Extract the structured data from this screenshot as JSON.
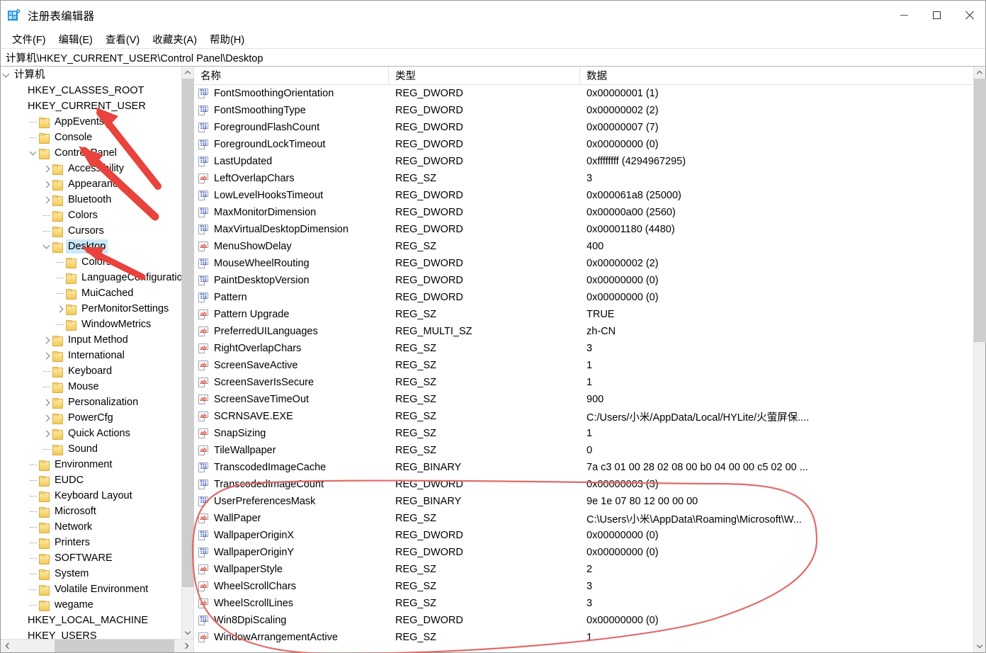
{
  "window": {
    "title": "注册表编辑器",
    "icon": "registry-editor-icon",
    "minimize_label": "最小化",
    "maximize_label": "最大化",
    "close_label": "关闭"
  },
  "menu": {
    "items": [
      {
        "label": "文件(F)",
        "name": "menu-file"
      },
      {
        "label": "编辑(E)",
        "name": "menu-edit"
      },
      {
        "label": "查看(V)",
        "name": "menu-view"
      },
      {
        "label": "收藏夹(A)",
        "name": "menu-favorites"
      },
      {
        "label": "帮助(H)",
        "name": "menu-help"
      }
    ]
  },
  "address": {
    "path": "计算机\\HKEY_CURRENT_USER\\Control Panel\\Desktop"
  },
  "tree": {
    "nodes": [
      {
        "label": "计算机",
        "indent": 0,
        "expander": "open",
        "folder": false,
        "selected": false
      },
      {
        "label": "HKEY_CLASSES_ROOT",
        "indent": 1,
        "expander": "collapsed-hidden",
        "folder": false,
        "selected": false
      },
      {
        "label": "HKEY_CURRENT_USER",
        "indent": 1,
        "expander": "collapsed-hidden",
        "folder": false,
        "selected": false
      },
      {
        "label": "AppEvents",
        "indent": 2,
        "expander": "dot",
        "folder": true,
        "selected": false
      },
      {
        "label": "Console",
        "indent": 2,
        "expander": "dot",
        "folder": true,
        "selected": false
      },
      {
        "label": "Control Panel",
        "indent": 2,
        "expander": "open",
        "folder": true,
        "selected": false
      },
      {
        "label": "Accessibility",
        "indent": 3,
        "expander": "closed",
        "folder": true,
        "selected": false
      },
      {
        "label": "Appearance",
        "indent": 3,
        "expander": "closed",
        "folder": true,
        "selected": false
      },
      {
        "label": "Bluetooth",
        "indent": 3,
        "expander": "closed",
        "folder": true,
        "selected": false
      },
      {
        "label": "Colors",
        "indent": 3,
        "expander": "dot",
        "folder": true,
        "selected": false
      },
      {
        "label": "Cursors",
        "indent": 3,
        "expander": "dot",
        "folder": true,
        "selected": false
      },
      {
        "label": "Desktop",
        "indent": 3,
        "expander": "open",
        "folder": true,
        "selected": true
      },
      {
        "label": "Colors",
        "indent": 4,
        "expander": "dot",
        "folder": true,
        "selected": false
      },
      {
        "label": "LanguageConfiguration",
        "indent": 4,
        "expander": "dot",
        "folder": true,
        "selected": false
      },
      {
        "label": "MuiCached",
        "indent": 4,
        "expander": "dot",
        "folder": true,
        "selected": false
      },
      {
        "label": "PerMonitorSettings",
        "indent": 4,
        "expander": "closed",
        "folder": true,
        "selected": false
      },
      {
        "label": "WindowMetrics",
        "indent": 4,
        "expander": "dot",
        "folder": true,
        "selected": false
      },
      {
        "label": "Input Method",
        "indent": 3,
        "expander": "closed",
        "folder": true,
        "selected": false
      },
      {
        "label": "International",
        "indent": 3,
        "expander": "closed",
        "folder": true,
        "selected": false
      },
      {
        "label": "Keyboard",
        "indent": 3,
        "expander": "dot",
        "folder": true,
        "selected": false
      },
      {
        "label": "Mouse",
        "indent": 3,
        "expander": "dot",
        "folder": true,
        "selected": false
      },
      {
        "label": "Personalization",
        "indent": 3,
        "expander": "closed",
        "folder": true,
        "selected": false
      },
      {
        "label": "PowerCfg",
        "indent": 3,
        "expander": "closed",
        "folder": true,
        "selected": false
      },
      {
        "label": "Quick Actions",
        "indent": 3,
        "expander": "closed",
        "folder": true,
        "selected": false
      },
      {
        "label": "Sound",
        "indent": 3,
        "expander": "dot",
        "folder": true,
        "selected": false
      },
      {
        "label": "Environment",
        "indent": 2,
        "expander": "dot",
        "folder": true,
        "selected": false
      },
      {
        "label": "EUDC",
        "indent": 2,
        "expander": "dot",
        "folder": true,
        "selected": false
      },
      {
        "label": "Keyboard Layout",
        "indent": 2,
        "expander": "dot",
        "folder": true,
        "selected": false
      },
      {
        "label": "Microsoft",
        "indent": 2,
        "expander": "dot",
        "folder": true,
        "selected": false
      },
      {
        "label": "Network",
        "indent": 2,
        "expander": "dot",
        "folder": true,
        "selected": false
      },
      {
        "label": "Printers",
        "indent": 2,
        "expander": "dot",
        "folder": true,
        "selected": false
      },
      {
        "label": "SOFTWARE",
        "indent": 2,
        "expander": "dot",
        "folder": true,
        "selected": false
      },
      {
        "label": "System",
        "indent": 2,
        "expander": "dot",
        "folder": true,
        "selected": false
      },
      {
        "label": "Volatile Environment",
        "indent": 2,
        "expander": "dot",
        "folder": true,
        "selected": false
      },
      {
        "label": "wegame",
        "indent": 2,
        "expander": "dot",
        "folder": true,
        "selected": false
      },
      {
        "label": "HKEY_LOCAL_MACHINE",
        "indent": 1,
        "expander": "collapsed-hidden",
        "folder": false,
        "selected": false
      },
      {
        "label": "HKEY_USERS",
        "indent": 1,
        "expander": "collapsed-hidden",
        "folder": false,
        "selected": false
      }
    ]
  },
  "list": {
    "columns": [
      {
        "label": "名称",
        "name": "column-header-name"
      },
      {
        "label": "类型",
        "name": "column-header-type"
      },
      {
        "label": "数据",
        "name": "column-header-data"
      }
    ],
    "rows": [
      {
        "icon": "dword-icon",
        "name": "FontSmoothingOrientation",
        "type": "REG_DWORD",
        "data": "0x00000001 (1)"
      },
      {
        "icon": "dword-icon",
        "name": "FontSmoothingType",
        "type": "REG_DWORD",
        "data": "0x00000002 (2)"
      },
      {
        "icon": "dword-icon",
        "name": "ForegroundFlashCount",
        "type": "REG_DWORD",
        "data": "0x00000007 (7)"
      },
      {
        "icon": "dword-icon",
        "name": "ForegroundLockTimeout",
        "type": "REG_DWORD",
        "data": "0x00000000 (0)"
      },
      {
        "icon": "dword-icon",
        "name": "LastUpdated",
        "type": "REG_DWORD",
        "data": "0xffffffff (4294967295)"
      },
      {
        "icon": "string-icon",
        "name": "LeftOverlapChars",
        "type": "REG_SZ",
        "data": "3"
      },
      {
        "icon": "dword-icon",
        "name": "LowLevelHooksTimeout",
        "type": "REG_DWORD",
        "data": "0x000061a8 (25000)"
      },
      {
        "icon": "dword-icon",
        "name": "MaxMonitorDimension",
        "type": "REG_DWORD",
        "data": "0x00000a00 (2560)"
      },
      {
        "icon": "dword-icon",
        "name": "MaxVirtualDesktopDimension",
        "type": "REG_DWORD",
        "data": "0x00001180 (4480)"
      },
      {
        "icon": "string-icon",
        "name": "MenuShowDelay",
        "type": "REG_SZ",
        "data": "400"
      },
      {
        "icon": "dword-icon",
        "name": "MouseWheelRouting",
        "type": "REG_DWORD",
        "data": "0x00000002 (2)"
      },
      {
        "icon": "dword-icon",
        "name": "PaintDesktopVersion",
        "type": "REG_DWORD",
        "data": "0x00000000 (0)"
      },
      {
        "icon": "dword-icon",
        "name": "Pattern",
        "type": "REG_DWORD",
        "data": "0x00000000 (0)"
      },
      {
        "icon": "string-icon",
        "name": "Pattern Upgrade",
        "type": "REG_SZ",
        "data": "TRUE"
      },
      {
        "icon": "string-icon",
        "name": "PreferredUILanguages",
        "type": "REG_MULTI_SZ",
        "data": "zh-CN"
      },
      {
        "icon": "string-icon",
        "name": "RightOverlapChars",
        "type": "REG_SZ",
        "data": "3"
      },
      {
        "icon": "string-icon",
        "name": "ScreenSaveActive",
        "type": "REG_SZ",
        "data": "1"
      },
      {
        "icon": "string-icon",
        "name": "ScreenSaverIsSecure",
        "type": "REG_SZ",
        "data": "1"
      },
      {
        "icon": "string-icon",
        "name": "ScreenSaveTimeOut",
        "type": "REG_SZ",
        "data": "900"
      },
      {
        "icon": "string-icon",
        "name": "SCRNSAVE.EXE",
        "type": "REG_SZ",
        "data": "C:/Users/小米/AppData/Local/HYLite/火萤屏保...."
      },
      {
        "icon": "string-icon",
        "name": "SnapSizing",
        "type": "REG_SZ",
        "data": "1"
      },
      {
        "icon": "string-icon",
        "name": "TileWallpaper",
        "type": "REG_SZ",
        "data": "0"
      },
      {
        "icon": "dword-icon",
        "name": "TranscodedImageCache",
        "type": "REG_BINARY",
        "data": "7a c3 01 00 28 02 08 00 b0 04 00 00 c5 02 00 ..."
      },
      {
        "icon": "dword-icon",
        "name": "TranscodedImageCount",
        "type": "REG_DWORD",
        "data": "0x00000003 (3)"
      },
      {
        "icon": "dword-icon",
        "name": "UserPreferencesMask",
        "type": "REG_BINARY",
        "data": "9e 1e 07 80 12 00 00 00"
      },
      {
        "icon": "string-icon",
        "name": "WallPaper",
        "type": "REG_SZ",
        "data": "C:\\Users\\小米\\AppData\\Roaming\\Microsoft\\W..."
      },
      {
        "icon": "dword-icon",
        "name": "WallpaperOriginX",
        "type": "REG_DWORD",
        "data": "0x00000000 (0)"
      },
      {
        "icon": "dword-icon",
        "name": "WallpaperOriginY",
        "type": "REG_DWORD",
        "data": "0x00000000 (0)"
      },
      {
        "icon": "string-icon",
        "name": "WallpaperStyle",
        "type": "REG_SZ",
        "data": "2"
      },
      {
        "icon": "string-icon",
        "name": "WheelScrollChars",
        "type": "REG_SZ",
        "data": "3"
      },
      {
        "icon": "string-icon",
        "name": "WheelScrollLines",
        "type": "REG_SZ",
        "data": "3"
      },
      {
        "icon": "dword-icon",
        "name": "Win8DpiScaling",
        "type": "REG_DWORD",
        "data": "0x00000000 (0)"
      },
      {
        "icon": "string-icon",
        "name": "WindowArrangementActive",
        "type": "REG_SZ",
        "data": "1"
      }
    ]
  },
  "annotations": {
    "color": "#e8433c",
    "circle_color": "#e06b6b",
    "arrows": [
      {
        "name": "arrow-to-hkey-current-user"
      },
      {
        "name": "arrow-to-control-panel"
      },
      {
        "name": "arrow-to-desktop"
      }
    ],
    "ellipse": {
      "name": "highlight-ellipse-wallpaper-values"
    }
  }
}
